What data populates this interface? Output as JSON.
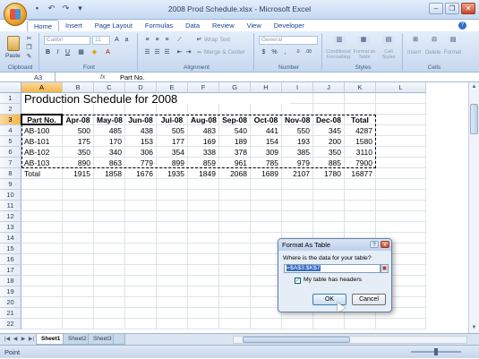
{
  "window": {
    "title": "2008 Prod Schedule.xlsx - Microsoft Excel"
  },
  "ribbon": {
    "tabs": [
      "Home",
      "Insert",
      "Page Layout",
      "Formulas",
      "Data",
      "Review",
      "View",
      "Developer"
    ],
    "clipboard": {
      "paste": "Paste",
      "label": "Clipboard"
    },
    "font": {
      "name": "Calibri",
      "size": "11",
      "label": "Font"
    },
    "alignment": {
      "wrap": "Wrap Text",
      "merge": "Merge & Center",
      "label": "Alignment"
    },
    "number": {
      "format": "General",
      "label": "Number"
    },
    "styles": {
      "conditional": "Conditional Formatting",
      "format_table": "Format as Table",
      "cell_styles": "Cell Styles",
      "label": "Styles"
    },
    "cells": {
      "insert": "Insert",
      "delete": "Delete",
      "format": "Format",
      "label": "Cells"
    }
  },
  "formula_bar": {
    "name_box": "A3",
    "fx": "fx",
    "content": "Part No."
  },
  "grid": {
    "columns": [
      "A",
      "B",
      "C",
      "D",
      "E",
      "F",
      "G",
      "H",
      "I",
      "J",
      "K",
      "L"
    ],
    "rows": [
      "1",
      "2",
      "3",
      "4",
      "5",
      "6",
      "7",
      "8",
      "9",
      "10",
      "11",
      "12",
      "13",
      "14",
      "15",
      "16",
      "17",
      "18",
      "19",
      "20",
      "21",
      "22"
    ],
    "title": "Production Schedule for 2008",
    "headers": [
      "Part No.",
      "Apr-08",
      "May-08",
      "Jun-08",
      "Jul-08",
      "Aug-08",
      "Sep-08",
      "Oct-08",
      "Nov-08",
      "Dec-08",
      "Total"
    ],
    "data": [
      [
        "AB-100",
        "500",
        "485",
        "438",
        "505",
        "483",
        "540",
        "441",
        "550",
        "345",
        "4287"
      ],
      [
        "AB-101",
        "175",
        "170",
        "153",
        "177",
        "169",
        "189",
        "154",
        "193",
        "200",
        "1580"
      ],
      [
        "AB-102",
        "350",
        "340",
        "306",
        "354",
        "338",
        "378",
        "309",
        "385",
        "350",
        "3110"
      ],
      [
        "AB-103",
        "890",
        "863",
        "779",
        "899",
        "859",
        "961",
        "785",
        "979",
        "885",
        "7900"
      ],
      [
        "Total",
        "1915",
        "1858",
        "1676",
        "1935",
        "1849",
        "2068",
        "1689",
        "2107",
        "1780",
        "16877"
      ]
    ]
  },
  "sheets": [
    "Sheet1",
    "Sheet2",
    "Sheet3"
  ],
  "status": {
    "mode": "Point"
  },
  "dialog": {
    "title": "Format As Table",
    "question": "Where is the data for your table?",
    "range": "=$A$3:$K$7",
    "checkbox_label": "My table has headers",
    "checkbox_checked": true,
    "ok": "OK",
    "cancel": "Cancel",
    "help": "?",
    "close": "x"
  }
}
